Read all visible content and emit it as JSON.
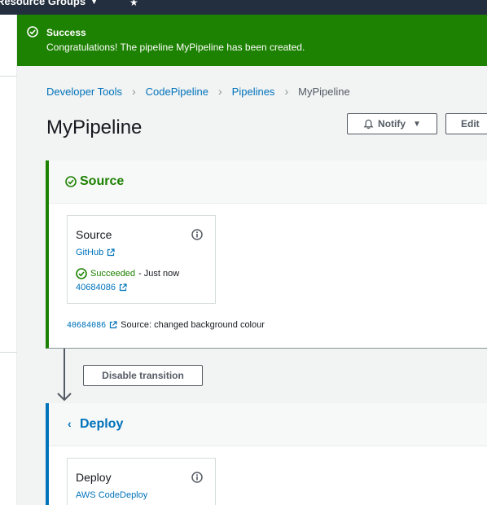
{
  "topnav": {
    "resource_groups": "Resource Groups"
  },
  "flash": {
    "title": "Success",
    "message": "Congratulations! The pipeline MyPipeline has been created."
  },
  "breadcrumb": [
    {
      "label": "Developer Tools"
    },
    {
      "label": "CodePipeline"
    },
    {
      "label": "Pipelines"
    },
    {
      "label": "MyPipeline"
    }
  ],
  "page": {
    "title": "MyPipeline",
    "notify_label": "Notify",
    "edit_label": "Edit"
  },
  "source_stage": {
    "name": "Source",
    "action": {
      "name": "Source",
      "provider": "GitHub",
      "status": "Succeeded",
      "time": "- Just now",
      "commit": "40684086"
    },
    "revision": {
      "id": "40684086",
      "message": "Source: changed background colour"
    }
  },
  "transition": {
    "button_label": "Disable transition"
  },
  "deploy_stage": {
    "name": "Deploy",
    "action": {
      "name": "Deploy",
      "provider": "AWS CodeDeploy"
    }
  },
  "colors": {
    "success": "#1d8102",
    "link": "#0073bb",
    "nav": "#232f3e"
  }
}
